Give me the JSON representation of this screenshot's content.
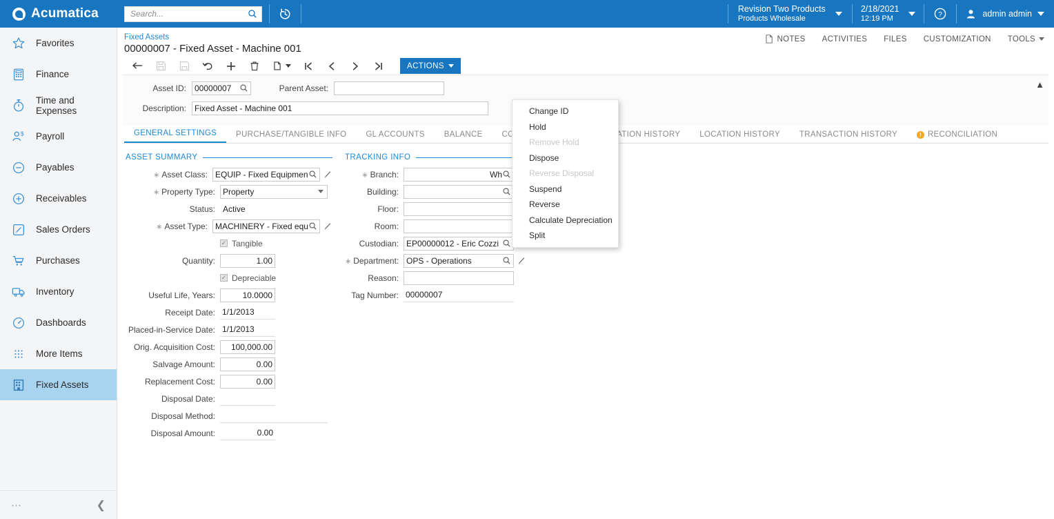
{
  "topbar": {
    "brand": "Acumatica",
    "search_placeholder": "Search...",
    "search_value": "",
    "recent_icon": "clock-history-icon",
    "company": {
      "line1": "Revision Two Products",
      "line2": "Products Wholesale"
    },
    "datetime": {
      "date": "2/18/2021",
      "time": "12:19 PM"
    },
    "help_icon": "help-circle-icon",
    "user": {
      "name": "admin admin",
      "avatar_icon": "user-icon"
    }
  },
  "sidebar": {
    "items": [
      {
        "label": "Favorites",
        "icon": "star-icon",
        "active": false
      },
      {
        "label": "Finance",
        "icon": "calculator-icon",
        "active": false
      },
      {
        "label": "Time and Expenses",
        "icon": "stopwatch-icon",
        "active": false
      },
      {
        "label": "Payroll",
        "icon": "person-dollar-icon",
        "active": false
      },
      {
        "label": "Payables",
        "icon": "minus-circle-icon",
        "active": false
      },
      {
        "label": "Receivables",
        "icon": "plus-circle-icon",
        "active": false
      },
      {
        "label": "Sales Orders",
        "icon": "pencil-square-icon",
        "active": false
      },
      {
        "label": "Purchases",
        "icon": "shopping-cart-icon",
        "active": false
      },
      {
        "label": "Inventory",
        "icon": "truck-icon",
        "active": false
      },
      {
        "label": "Dashboards",
        "icon": "gauge-icon",
        "active": false
      },
      {
        "label": "More Items",
        "icon": "grid-dots-icon",
        "active": false
      },
      {
        "label": "Fixed Assets",
        "icon": "building-icon",
        "active": true
      }
    ],
    "more_icon": "ellipsis-icon",
    "collapse_icon": "chevron-left-icon"
  },
  "page": {
    "breadcrumb": "Fixed Assets",
    "title": "00000007 - Fixed Asset - Machine 001",
    "collapse_icon": "chevron-up-icon",
    "head_links": [
      {
        "label": "NOTES",
        "icon": "note-icon"
      },
      {
        "label": "ACTIVITIES",
        "icon": ""
      },
      {
        "label": "FILES",
        "icon": ""
      },
      {
        "label": "CUSTOMIZATION",
        "icon": ""
      },
      {
        "label": "TOOLS",
        "icon": "caret-down-icon"
      }
    ]
  },
  "toolbar": {
    "buttons": [
      {
        "name": "back-button",
        "icon": "arrow-left-icon",
        "disabled": false
      },
      {
        "name": "save-button",
        "icon": "save-icon",
        "disabled": true
      },
      {
        "name": "save-and-close-button",
        "icon": "save-close-icon",
        "disabled": true
      },
      {
        "name": "undo-button",
        "icon": "undo-icon",
        "disabled": false
      },
      {
        "name": "add-new-record-button",
        "icon": "plus-icon",
        "disabled": false
      },
      {
        "name": "delete-button",
        "icon": "trash-icon",
        "disabled": false
      },
      {
        "name": "copy-paste-button",
        "icon": "copy-icon",
        "disabled": false
      },
      {
        "name": "first-record-button",
        "icon": "first-icon",
        "disabled": false
      },
      {
        "name": "previous-record-button",
        "icon": "previous-icon",
        "disabled": false
      },
      {
        "name": "next-record-button",
        "icon": "next-icon",
        "disabled": false
      },
      {
        "name": "last-record-button",
        "icon": "last-icon",
        "disabled": false
      }
    ],
    "actions_label": "ACTIONS"
  },
  "actions_menu": {
    "open": true,
    "items": [
      {
        "label": "Change ID",
        "disabled": false
      },
      {
        "label": "Hold",
        "disabled": false
      },
      {
        "label": "Remove Hold",
        "disabled": true
      },
      {
        "label": "Dispose",
        "disabled": false
      },
      {
        "label": "Reverse Disposal",
        "disabled": true
      },
      {
        "label": "Suspend",
        "disabled": false
      },
      {
        "label": "Reverse",
        "disabled": false
      },
      {
        "label": "Calculate Depreciation",
        "disabled": false
      },
      {
        "label": "Split",
        "disabled": false
      }
    ]
  },
  "header_form": {
    "asset_id_label": "Asset ID:",
    "asset_id_value": "00000007",
    "parent_asset_label": "Parent Asset:",
    "parent_asset_value": "",
    "description_label": "Description:",
    "description_value": "Fixed Asset - Machine 001"
  },
  "tabs": [
    {
      "label": "GENERAL SETTINGS",
      "active": true,
      "warn": false
    },
    {
      "label": "PURCHASE/TANGIBLE INFO",
      "active": false,
      "warn": false
    },
    {
      "label": "GL ACCOUNTS",
      "active": false,
      "warn": false
    },
    {
      "label": "BALANCE",
      "active": false,
      "warn": false
    },
    {
      "label": "COMPONENTS",
      "active": false,
      "warn": false
    },
    {
      "label": "DEPRECIATION HISTORY",
      "active": false,
      "warn": false
    },
    {
      "label": "LOCATION HISTORY",
      "active": false,
      "warn": false
    },
    {
      "label": "TRANSACTION HISTORY",
      "active": false,
      "warn": false
    },
    {
      "label": "RECONCILIATION",
      "active": false,
      "warn": true
    }
  ],
  "asset_summary": {
    "title": "ASSET SUMMARY",
    "fields": {
      "asset_class_label": "Asset Class:",
      "asset_class_value": "EQUIP - Fixed Equipment and",
      "property_type_label": "Property Type:",
      "property_type_value": "Property",
      "status_label": "Status:",
      "status_value": "Active",
      "asset_type_label": "Asset Type:",
      "asset_type_value": "MACHINERY - Fixed equipme",
      "tangible_label": "Tangible",
      "tangible_checked": true,
      "quantity_label": "Quantity:",
      "quantity_value": "1.00",
      "depreciable_label": "Depreciable",
      "depreciable_checked": true,
      "useful_life_label": "Useful Life, Years:",
      "useful_life_value": "10.0000",
      "receipt_date_label": "Receipt Date:",
      "receipt_date_value": "1/1/2013",
      "placed_in_service_label": "Placed-in-Service Date:",
      "placed_in_service_value": "1/1/2013",
      "orig_acquisition_label": "Orig. Acquisition Cost:",
      "orig_acquisition_value": "100,000.00",
      "salvage_label": "Salvage Amount:",
      "salvage_value": "0.00",
      "replacement_label": "Replacement Cost:",
      "replacement_value": "0.00",
      "disposal_date_label": "Disposal Date:",
      "disposal_date_value": "",
      "disposal_method_label": "Disposal Method:",
      "disposal_method_value": "",
      "disposal_amount_label": "Disposal Amount:",
      "disposal_amount_value": "0.00"
    }
  },
  "tracking_info": {
    "title": "TRACKING INFO",
    "fields": {
      "branch_label": "Branch:",
      "branch_value": "Wh",
      "building_label": "Building:",
      "building_value": "",
      "floor_label": "Floor:",
      "floor_value": "",
      "room_label": "Room:",
      "room_value": "",
      "custodian_label": "Custodian:",
      "custodian_value": "EP00000012 - Eric Cozzi",
      "department_label": "Department:",
      "department_value": "OPS - Operations",
      "reason_label": "Reason:",
      "reason_value": "",
      "tag_number_label": "Tag Number:",
      "tag_number_value": "00000007"
    }
  },
  "colors": {
    "brand_blue": "#1776bf",
    "link_blue": "#1b8ad6",
    "sidebar_bg": "#f4f5f7",
    "sidebar_active": "#a8d4f0",
    "warning": "#f5a623"
  }
}
